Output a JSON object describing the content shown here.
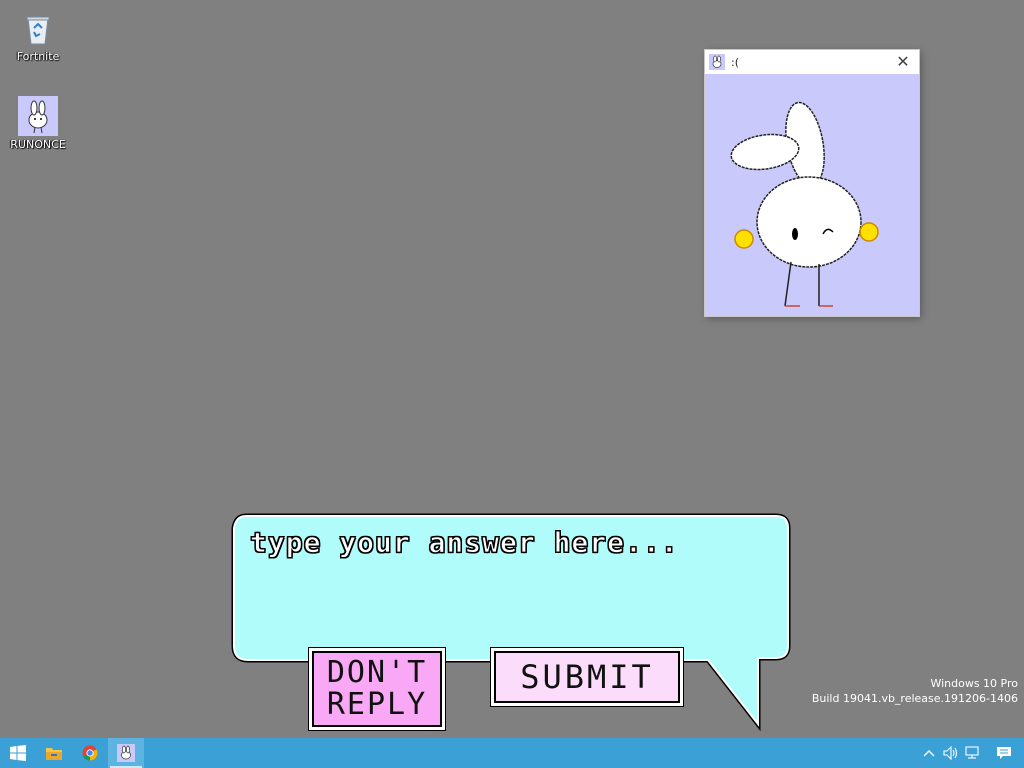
{
  "desktop": {
    "icons": [
      {
        "label": "Fortnite",
        "icon": "recycle-bin-icon"
      },
      {
        "label": "RUNONCE",
        "icon": "bunny-icon"
      }
    ]
  },
  "window": {
    "title": ":(",
    "close": "✕",
    "icon": "bunny-icon",
    "body_color": "#c9c9fb"
  },
  "dialog": {
    "placeholder": "type your answer here...",
    "dont_reply_line1": "DON'T",
    "dont_reply_line2": "REPLY",
    "submit_label": "SUBMIT",
    "bubble_color": "#b0fcfa",
    "dont_color": "#f8a8f4",
    "submit_color": "#fbdcfb"
  },
  "watermark": {
    "line1": "Windows 10 Pro",
    "line2": "Build 19041.vb_release.191206-1406"
  },
  "taskbar": {
    "color": "#3ba0d6",
    "items": [
      "start-icon",
      "file-explorer-icon",
      "chrome-icon",
      "bunny-app-icon"
    ],
    "tray": [
      "chevron-up-icon",
      "volume-icon",
      "network-icon",
      "notification-icon"
    ]
  }
}
